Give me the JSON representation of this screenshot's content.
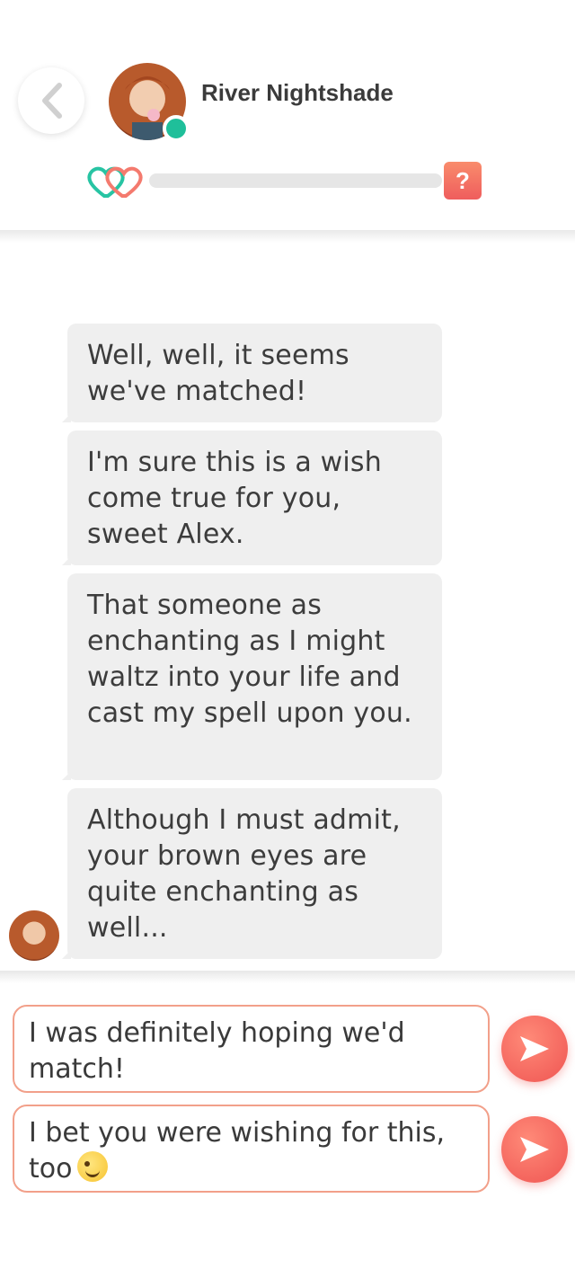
{
  "header": {
    "contact_name": "River Nightshade",
    "online": true,
    "affection_progress": 0,
    "help_label": "?"
  },
  "messages": [
    {
      "text": "Well, well, it seems we've matched!"
    },
    {
      "text": "I'm sure this is a wish come true for you, sweet Alex."
    },
    {
      "text": "That someone as enchanting as I might waltz into your life and cast my spell upon you."
    },
    {
      "text": "Although I must admit, your brown eyes are quite enchanting as well..."
    }
  ],
  "replies": [
    {
      "text": "I was definitely hoping we'd match!",
      "emoji": ""
    },
    {
      "text": "I bet you were wishing for this, too",
      "emoji": "wink-emoji"
    }
  ],
  "colors": {
    "accent": "#ef5d5d",
    "online": "#1fbf9a",
    "bubble": "#efefef",
    "reply_border": "#f2a08a"
  }
}
